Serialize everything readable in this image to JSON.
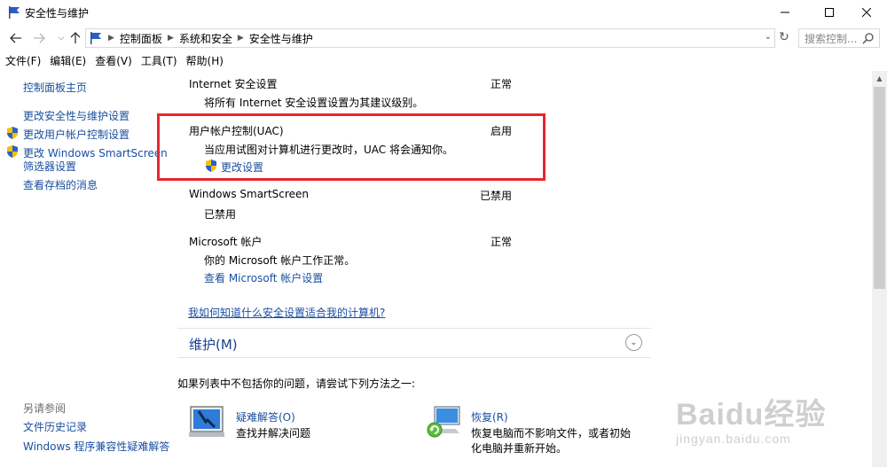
{
  "window": {
    "title": "安全性与维护"
  },
  "address": {
    "crumbs": [
      "控制面板",
      "系统和安全",
      "安全性与维护"
    ],
    "search_placeholder": "搜索控制..."
  },
  "menu": {
    "items": [
      "文件(F)",
      "编辑(E)",
      "查看(V)",
      "工具(T)",
      "帮助(H)"
    ]
  },
  "sidebar": {
    "home": "控制面板主页",
    "items": [
      {
        "label": "更改安全性与维护设置"
      },
      {
        "label": "更改用户帐户控制设置"
      },
      {
        "label_line1": "更改 Windows SmartScreen",
        "label_line2": "筛选器设置"
      },
      {
        "label": "查看存档的消息"
      }
    ],
    "see_also_title": "另请参阅",
    "see_also": [
      "文件历史记录",
      "Windows 程序兼容性疑难解答"
    ]
  },
  "security": {
    "internet": {
      "title": "Internet 安全设置",
      "status": "正常",
      "desc": "将所有 Internet 安全设置设置为其建议级别。"
    },
    "uac": {
      "title": "用户帐户控制(UAC)",
      "status": "启用",
      "desc": "当应用试图对计算机进行更改时，UAC 将会通知你。",
      "link": "更改设置"
    },
    "smartscreen": {
      "title": "Windows SmartScreen",
      "status": "已禁用",
      "desc": "已禁用"
    },
    "microsoft": {
      "title": "Microsoft 帐户",
      "status": "正常",
      "desc": "你的 Microsoft 帐户工作正常。",
      "link": "查看 Microsoft 帐户设置"
    },
    "help_link": "我如何知道什么安全设置适合我的计算机?"
  },
  "maintenance": {
    "title": "维护(M)"
  },
  "hint": "如果列表中不包括你的问题，请尝试下列方法之一:",
  "options": {
    "troubleshoot": {
      "title": "疑难解答(O)",
      "desc": "查找并解决问题"
    },
    "recovery": {
      "title": "恢复(R)",
      "desc_line1": "恢复电脑而不影响文件，或者初始",
      "desc_line2": "化电脑并重新开始。"
    }
  },
  "watermark": {
    "line1": "Baidu经验",
    "line2": "jingyan.baidu.com"
  },
  "colors": {
    "link": "#1a4fa0",
    "highlight_box": "#e8262d",
    "section_header": "#1c3f94"
  }
}
